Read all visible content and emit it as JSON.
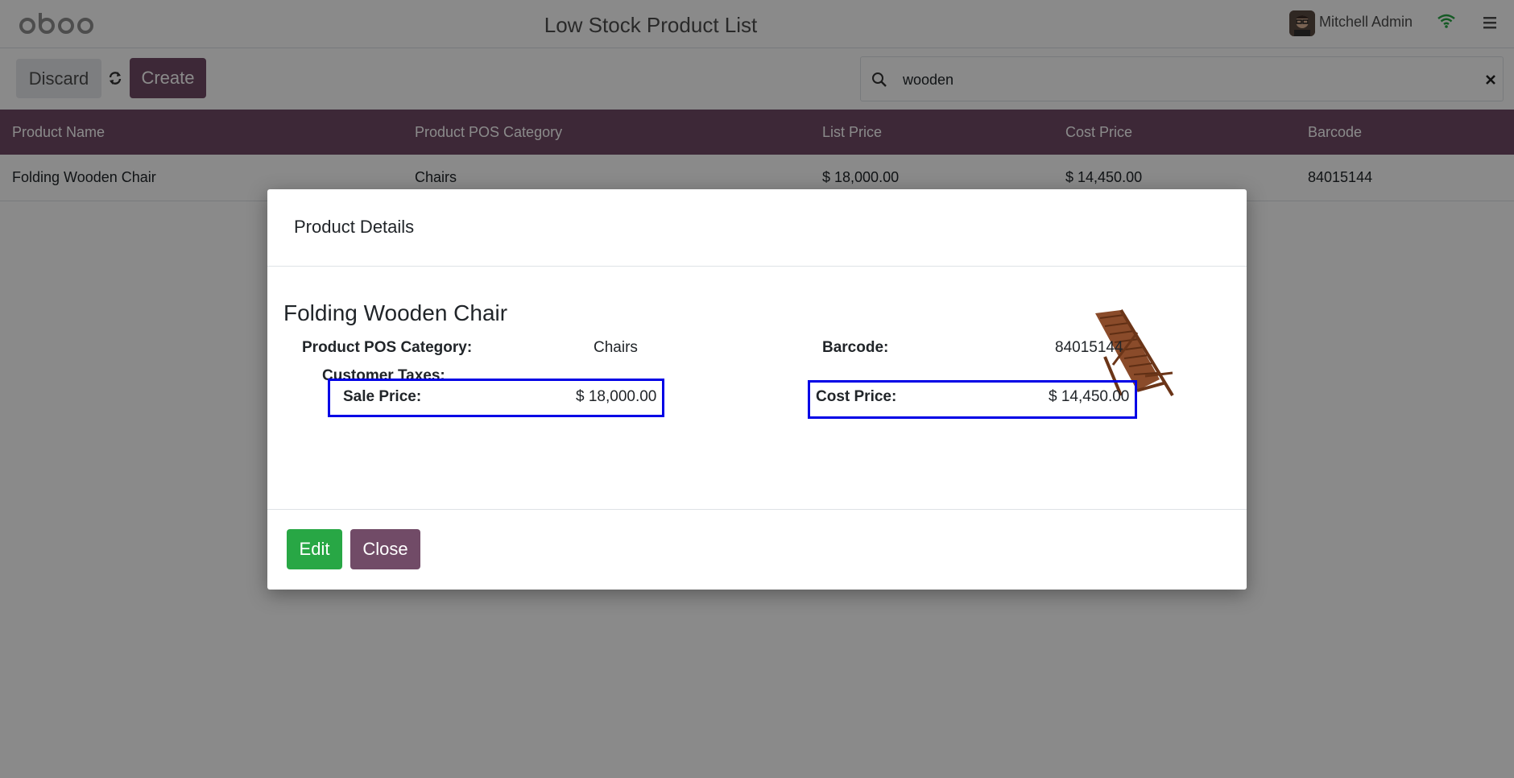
{
  "header": {
    "title": "Low Stock Product List",
    "user_name": "Mitchell Admin"
  },
  "control_panel": {
    "discard_label": "Discard",
    "create_label": "Create",
    "search": {
      "value": "wooden",
      "placeholder": ""
    }
  },
  "table": {
    "columns": [
      "Product Name",
      "Product POS Category",
      "List Price",
      "Cost Price",
      "Barcode"
    ],
    "rows": [
      [
        "Folding Wooden Chair",
        "Chairs",
        "$ 18,000.00",
        "$ 14,450.00",
        "84015144"
      ]
    ]
  },
  "dialog": {
    "title": "Product Details",
    "product_name": "Folding Wooden Chair",
    "pos_category_label": "Product POS Category:",
    "pos_category_value": "Chairs",
    "barcode_label": "Barcode:",
    "barcode_value": "84015144",
    "customer_taxes_label": "Customer Taxes:",
    "sale_price_label": "Sale Price:",
    "sale_price_value": "$ 18,000.00",
    "cost_price_label": "Cost Price:",
    "cost_price_value": "$ 14,450.00",
    "edit_label": "Edit",
    "close_label": "Close"
  },
  "colors": {
    "brand": "#714b67",
    "success": "#28a745",
    "highlight": "#0000e6"
  },
  "icons": [
    "odoo-logo",
    "avatar",
    "wifi-icon",
    "menu-icon",
    "refresh-icon",
    "search-icon",
    "clear-icon",
    "chair-image"
  ]
}
